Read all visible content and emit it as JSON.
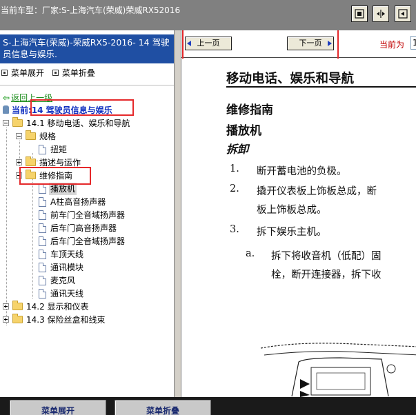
{
  "top": {
    "title": "当前车型：厂家:S-上海汽车(荣威)荣威RX52016"
  },
  "left": {
    "header": "S-上海汽车(荣威)-荣威RX5-2016- 14 驾驶员信息与娱乐.",
    "menu_expand": "菜单展开",
    "menu_collapse": "菜单折叠",
    "back": "返回上一级",
    "current": "当前:14 驾驶员信息与娱乐",
    "tree": [
      {
        "label": "14.1 移动电话、娱乐和导航"
      },
      {
        "label": "规格"
      },
      {
        "label": "扭矩"
      },
      {
        "label": "描述与运作"
      },
      {
        "label": "维修指南"
      },
      {
        "label": "播放机"
      },
      {
        "label": "A柱高音扬声器"
      },
      {
        "label": "前车门全音域扬声器"
      },
      {
        "label": "后车门高音扬声器"
      },
      {
        "label": "后车门全音域扬声器"
      },
      {
        "label": "车顶天线"
      },
      {
        "label": "通讯模块"
      },
      {
        "label": "麦克风"
      },
      {
        "label": "通讯天线"
      },
      {
        "label": "14.2 显示和仪表"
      },
      {
        "label": "14.3 保险丝盒和线束"
      }
    ]
  },
  "right": {
    "prev_label": "上一页",
    "next_label": "下一页",
    "current_page_label": "当前为",
    "current_page_value": "1",
    "doc": {
      "h1": "移动电话、娱乐和导航",
      "h2a": "维修指南",
      "h2b": "播放机",
      "h3": "拆卸",
      "steps": [
        {
          "num": "1.",
          "text": "断开蓄电池的负极。"
        },
        {
          "num": "2.",
          "text": "撬开仪表板上饰板总成，断"
        },
        {
          "num": "",
          "text": "板上饰板总成。"
        },
        {
          "num": "3.",
          "text": "拆下娱乐主机。"
        },
        {
          "num": "a.",
          "text": "拆下将收音机（低配）固"
        },
        {
          "num": "",
          "text": "栓，断开连接器，拆下收"
        }
      ]
    }
  },
  "bottom": {
    "expand": "菜单展开",
    "collapse": "菜单折叠"
  },
  "colors": {
    "header_blue": "#1f4fa3",
    "highlight_red": "#e5282a",
    "link_green": "#1a8c1a",
    "current_blue": "#1030c0"
  },
  "icons": [
    "tile-view-icon",
    "split-view-icon",
    "fit-view-icon",
    "folder-icon",
    "document-icon",
    "back-arrow-icon",
    "pin-icon"
  ]
}
